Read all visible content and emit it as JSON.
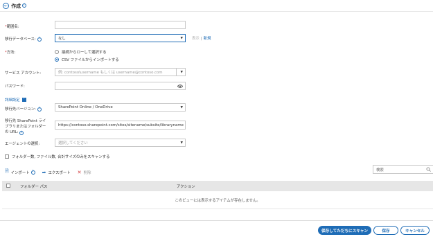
{
  "header": {
    "title": "作成"
  },
  "form": {
    "name": {
      "label": "範囲名:",
      "value": ""
    },
    "migration_db": {
      "label": "移行データベース:",
      "value": "なし",
      "link_show": "表示",
      "link_new": "新規"
    },
    "method": {
      "label": "方法:",
      "options": [
        "接続からローして選択する",
        "CSV ファイルからインポートする"
      ],
      "selected_index": 1
    },
    "service_account": {
      "label": "サービス アカウント:",
      "placeholder": "例: contoso\\username もしくは username@contoso.com"
    },
    "password": {
      "label": "パスワード:"
    },
    "advanced": {
      "label": "詳細設定",
      "checked": true
    },
    "target_version": {
      "label": "移行先バージョン:",
      "value": "SharePoint Online / OneDrive"
    },
    "target_url": {
      "label": "移行先 SharePoint ライブラリまたはフォルダーの URL:",
      "value": "https://contoso.sharepoint.com/sites/sitename/subsite/libraryname"
    },
    "agent": {
      "label": "エージェントの選択:",
      "placeholder": "選択してください"
    },
    "scan_option": {
      "label": "フォルダー数, ファイル数, 合計サイズのみをスキャンする",
      "checked": false
    }
  },
  "toolbar": {
    "import_label": "インポート",
    "export_label": "エクスポート",
    "delete_label": "削除",
    "search_placeholder": "検索"
  },
  "table": {
    "columns": [
      "フォルダー パス",
      "アクション"
    ],
    "empty_message": "このビューには表示するアイテムが存在しません。"
  },
  "footer": {
    "save_scan_label": "保存してただちにスキャン",
    "save_label": "保存",
    "cancel_label": "キャンセル"
  },
  "colors": {
    "accent": "#1e6cb6",
    "required": "#d13438",
    "header_bg": "#e6e6e6"
  }
}
